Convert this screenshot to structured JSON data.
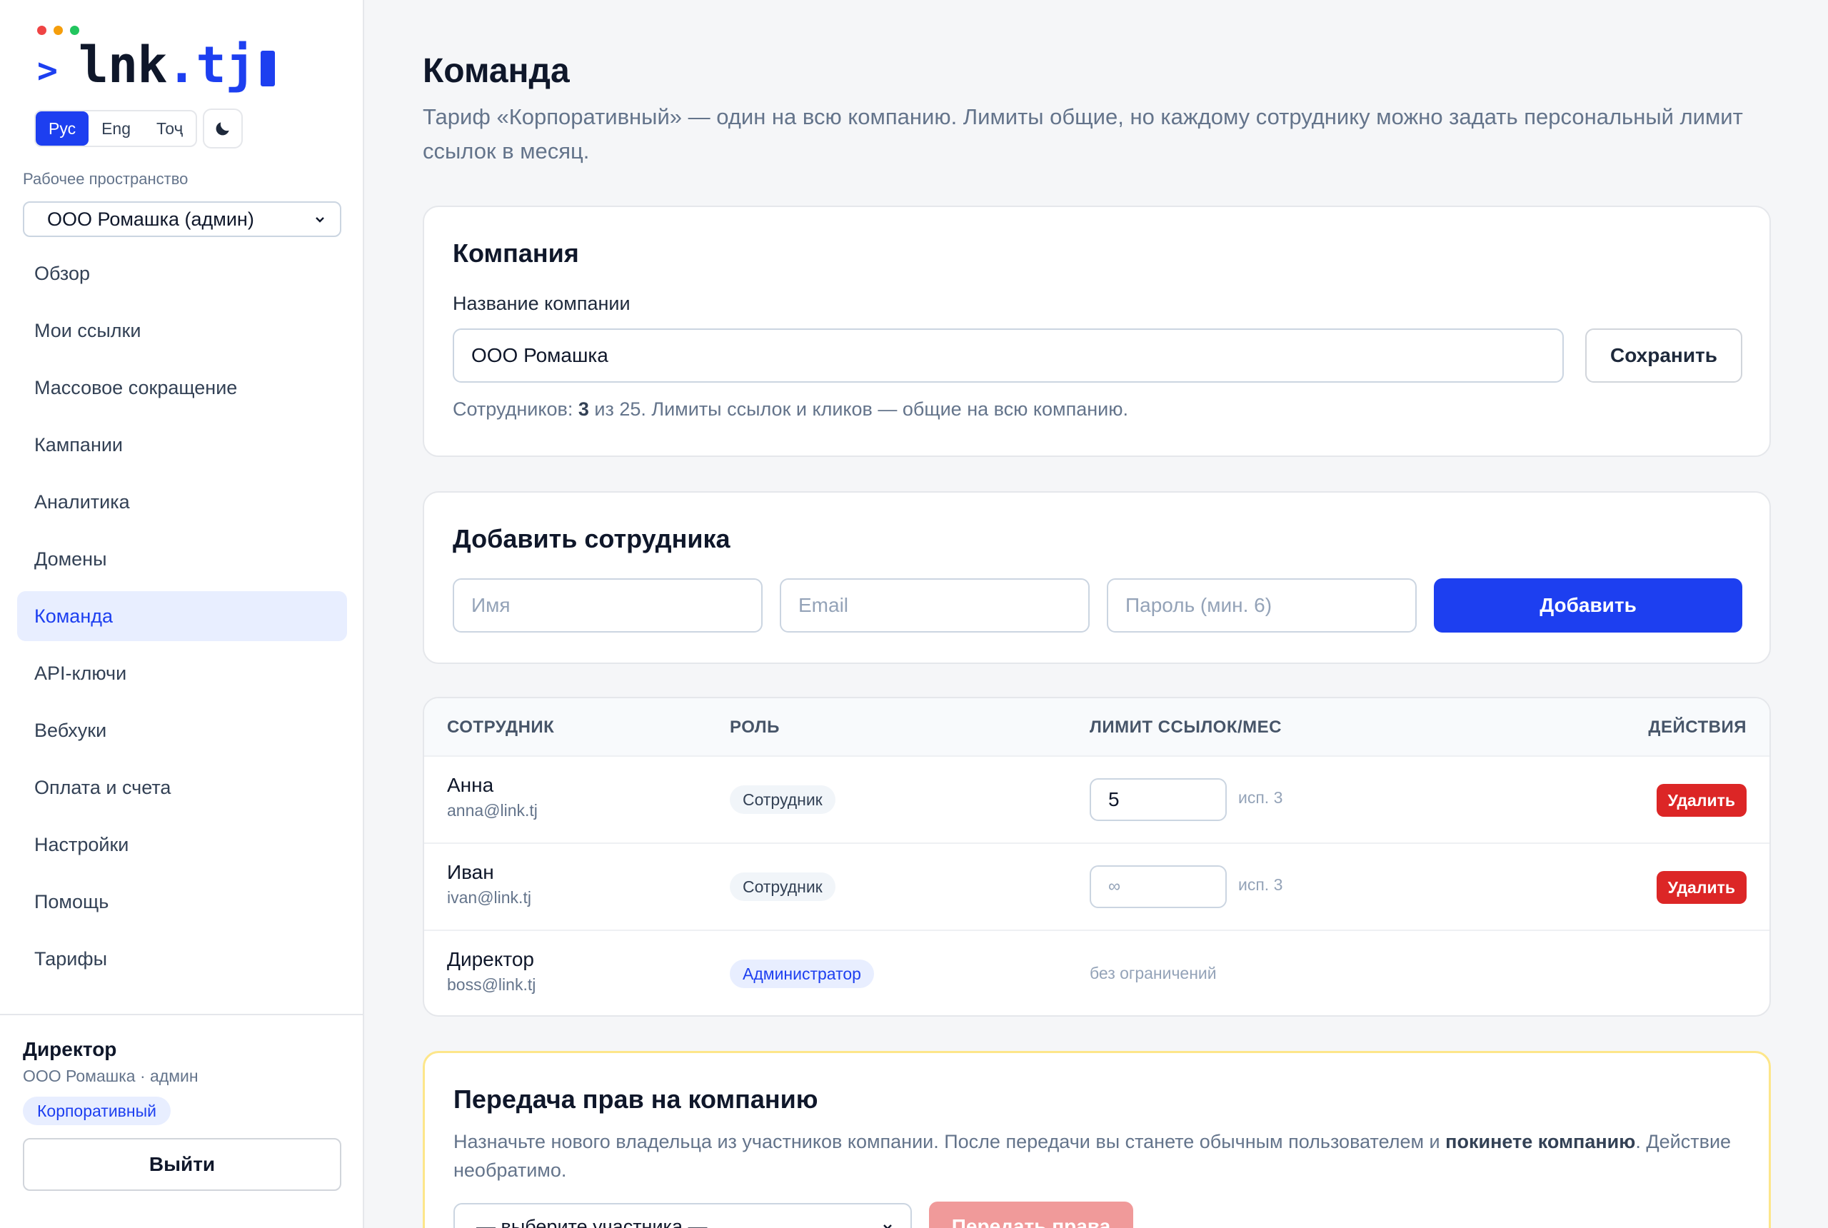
{
  "brand": {
    "prompt": ">",
    "name_a": "lnk",
    "name_dot": ".",
    "name_b": "tj",
    "dot_colors": [
      "#ef4444",
      "#f59e0b",
      "#22c55e"
    ],
    "accent": "#1d3ff0"
  },
  "languages": [
    {
      "label": "Рус",
      "active": true
    },
    {
      "label": "Eng",
      "active": false
    },
    {
      "label": "Тоҷ",
      "active": false
    }
  ],
  "theme_toggle": {
    "icon": "moon-icon"
  },
  "workspace": {
    "label": "Рабочее пространство",
    "selected": "ООО Ромашка (админ)"
  },
  "nav": [
    {
      "label": "Обзор"
    },
    {
      "label": "Мои ссылки"
    },
    {
      "label": "Массовое сокращение"
    },
    {
      "label": "Кампании"
    },
    {
      "label": "Аналитика"
    },
    {
      "label": "Домены"
    },
    {
      "label": "Команда",
      "active": true
    },
    {
      "label": "API-ключи"
    },
    {
      "label": "Вебхуки"
    },
    {
      "label": "Оплата и счета"
    },
    {
      "label": "Настройки"
    },
    {
      "label": "Помощь"
    },
    {
      "label": "Тарифы"
    }
  ],
  "user": {
    "name": "Директор",
    "sub": "ООО Ромашка · админ",
    "plan": "Корпоративный",
    "logout": "Выйти"
  },
  "page": {
    "title": "Команда",
    "description": "Тариф «Корпоративный» — один на всю компанию. Лимиты общие, но каждому сотруднику можно задать персональный лимит ссылок в месяц."
  },
  "company": {
    "title": "Компания",
    "field_label": "Название компании",
    "field_value": "ООО Ромашка",
    "save": "Сохранить",
    "note_prefix": "Сотрудников: ",
    "note_count": "3",
    "note_suffix": " из 25. Лимиты ссылок и кликов — общие на всю компанию."
  },
  "add_employee": {
    "title": "Добавить сотрудника",
    "name_placeholder": "Имя",
    "email_placeholder": "Email",
    "password_placeholder": "Пароль (мин. 6)",
    "submit": "Добавить"
  },
  "table": {
    "headers": {
      "employee": "СОТРУДНИК",
      "role": "РОЛЬ",
      "limit": "ЛИМИТ ССЫЛОК/МЕС",
      "actions": "ДЕЙСТВИЯ"
    },
    "rows": [
      {
        "name": "Анна",
        "email": "anna@link.tj",
        "role": "Сотрудник",
        "limit_value": "5",
        "used": "исп. 3",
        "delete": "Удалить"
      },
      {
        "name": "Иван",
        "email": "ivan@link.tj",
        "role": "Сотрудник",
        "limit_placeholder": "∞",
        "used": "исп. 3",
        "delete": "Удалить"
      },
      {
        "name": "Директор",
        "email": "boss@link.tj",
        "role": "Администратор",
        "no_limit": "без ограничений"
      }
    ]
  },
  "transfer": {
    "title": "Передача прав на компанию",
    "desc_prefix": "Назначьте нового владельца из участников компании. После передачи вы станете обычным пользователем и ",
    "desc_bold": "покинете компанию",
    "desc_suffix": ". Действие необратимо.",
    "select_placeholder": "— выберите участника —",
    "button": "Передать права"
  }
}
